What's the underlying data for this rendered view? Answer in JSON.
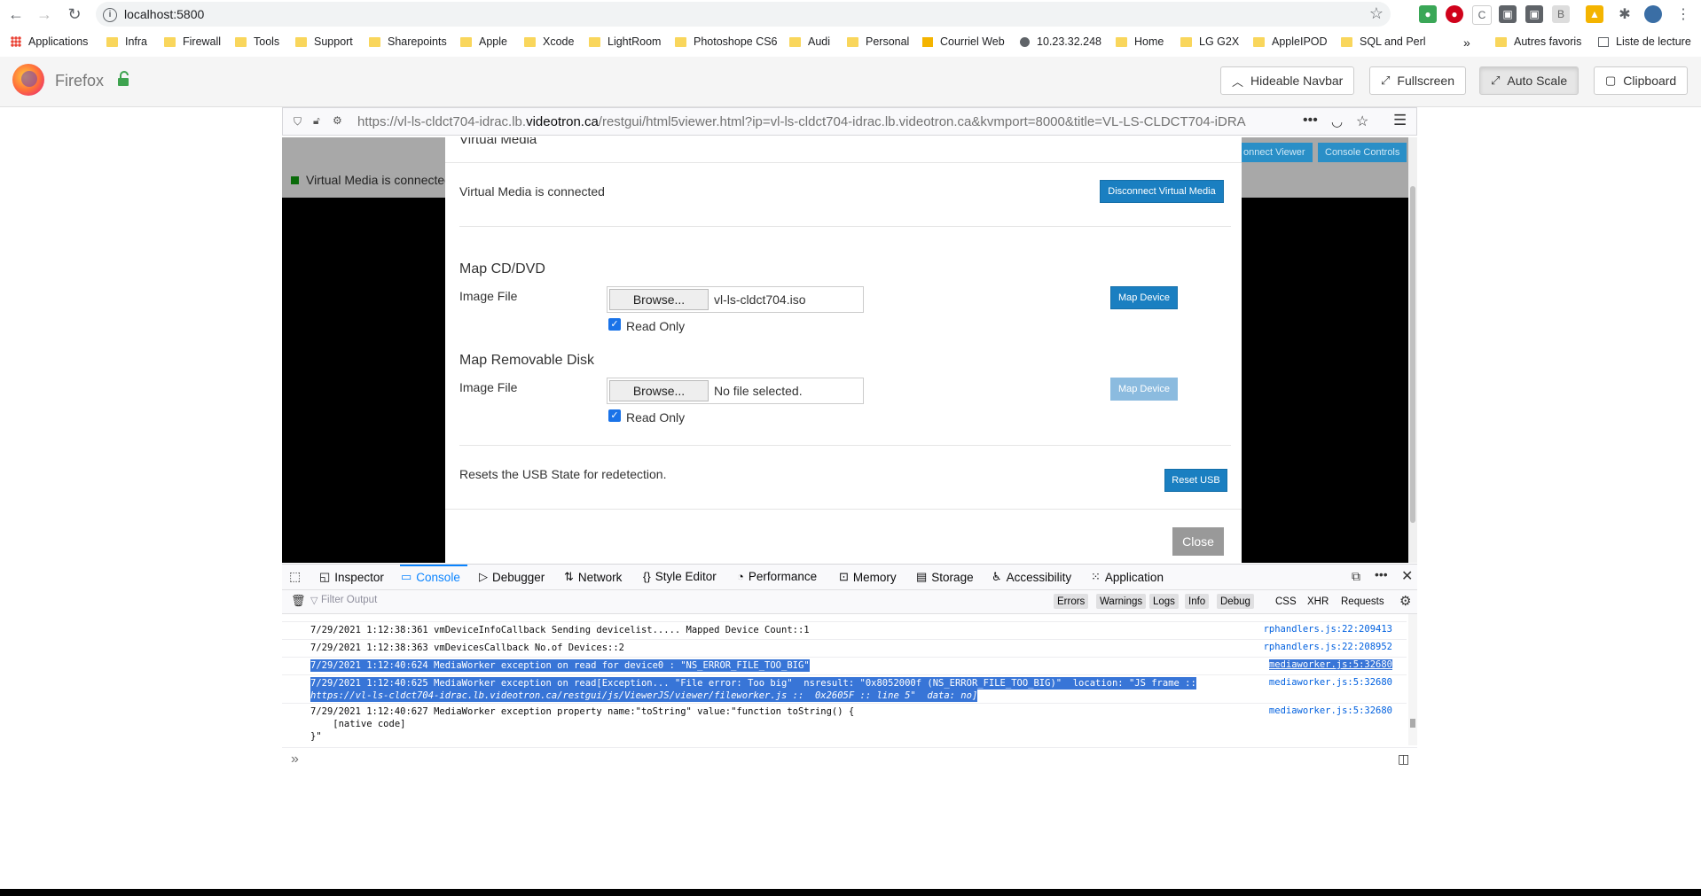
{
  "browser": {
    "url": "localhost:5800",
    "bookmarks": [
      {
        "label": "Applications",
        "icon": "apps-grid-icon"
      },
      {
        "label": "Infra",
        "icon": "folder-icon"
      },
      {
        "label": "Firewall",
        "icon": "folder-icon"
      },
      {
        "label": "Tools",
        "icon": "folder-icon"
      },
      {
        "label": "Support",
        "icon": "folder-icon"
      },
      {
        "label": "Sharepoints",
        "icon": "folder-icon"
      },
      {
        "label": "Apple",
        "icon": "folder-icon"
      },
      {
        "label": "Xcode",
        "icon": "folder-icon"
      },
      {
        "label": "LightRoom",
        "icon": "folder-icon"
      },
      {
        "label": "Photoshope CS6",
        "icon": "folder-icon"
      },
      {
        "label": "Audi",
        "icon": "folder-icon"
      },
      {
        "label": "Personal",
        "icon": "folder-icon"
      },
      {
        "label": "Courriel Web",
        "icon": "mail-icon"
      },
      {
        "label": "10.23.32.248",
        "icon": "globe-icon"
      },
      {
        "label": "Home",
        "icon": "folder-icon"
      },
      {
        "label": "LG G2X",
        "icon": "folder-icon"
      },
      {
        "label": "AppleIPOD",
        "icon": "folder-icon"
      },
      {
        "label": "SQL and Perl",
        "icon": "folder-icon"
      },
      {
        "label": "Autres favoris",
        "icon": "folder-icon"
      },
      {
        "label": "Liste de lecture",
        "icon": "reading-list-icon"
      }
    ],
    "more_bookmarks": "»"
  },
  "app_navbar": {
    "title": "Firefox",
    "buttons": {
      "hideable": "Hideable Navbar",
      "fullscreen": "Fullscreen",
      "autoscale": "Auto Scale",
      "clipboard": "Clipboard"
    }
  },
  "firefox": {
    "url_prefix": "https://vl-ls-cldct704-idrac.lb.",
    "url_domain": "videotron.ca",
    "url_suffix": "/restgui/html5viewer.html?ip=vl-ls-cldct704-idrac.lb.videotron.ca&kvmport=8000&title=VL-LS-CLDCT704-iDRA"
  },
  "viewer": {
    "status_bg": "Virtual Media is connected",
    "btn_disconnect_viewer": "onnect Viewer",
    "btn_console_controls": "Console Controls"
  },
  "modal": {
    "title": "Virtual Media",
    "status": "Virtual Media is connected",
    "disconnect_btn": "Disconnect Virtual Media",
    "cd_heading": "Map CD/DVD",
    "cd_image_label": "Image File",
    "cd_browse": "Browse...",
    "cd_file": "vl-ls-cldct704.iso",
    "cd_readonly": "Read Only",
    "cd_map_btn": "Map Device",
    "rd_heading": "Map Removable Disk",
    "rd_image_label": "Image File",
    "rd_browse": "Browse...",
    "rd_file": "No file selected.",
    "rd_readonly": "Read Only",
    "rd_map_btn": "Map Device",
    "reset_text": "Resets the USB State for redetection.",
    "reset_btn": "Reset USB",
    "close_btn": "Close"
  },
  "devtools": {
    "tabs": [
      "Inspector",
      "Console",
      "Debugger",
      "Network",
      "Style Editor",
      "Performance",
      "Memory",
      "Storage",
      "Accessibility",
      "Application"
    ],
    "selected_tab": "Console",
    "filter_placeholder": "Filter Output",
    "filters": [
      "Errors",
      "Warnings",
      "Logs",
      "Info",
      "Debug"
    ],
    "filters2": [
      "CSS",
      "XHR",
      "Requests"
    ],
    "rows": [
      {
        "msg": "7/29/2021 1:12:38:361 vmDeviceInfoCallback Sending devicelist..... Mapped Device Count::1",
        "src": "rphandlers.js:22:209413"
      },
      {
        "msg": "7/29/2021 1:12:38:363 vmDevicesCallback No.of Devices::2",
        "src": "rphandlers.js:22:208952"
      },
      {
        "msg": "7/29/2021 1:12:40:624 MediaWorker exception on read for device0 : \"NS_ERROR_FILE_TOO_BIG\"",
        "src": "mediaworker.js:5:32680"
      },
      {
        "msg": "7/29/2021 1:12:40:625 MediaWorker exception on read[Exception... \"File error: Too big\"  nsresult: \"0x8052000f (NS_ERROR_FILE_TOO_BIG)\"  location: \"JS frame ::",
        "msg2": "https://vl-ls-cldct704-idrac.lb.videotron.ca/restgui/js/ViewerJS/viewer/fileworker.js ::  0x2605F :: line 5\"  data: no]",
        "src": "mediaworker.js:5:32680"
      },
      {
        "msg": "7/29/2021 1:12:40:627 MediaWorker exception property name:\"toString\" value:\"function toString() {",
        "msg2": "    [native code]",
        "msg3": "}\"",
        "src": "mediaworker.js:5:32680"
      }
    ],
    "prompt": "»"
  }
}
